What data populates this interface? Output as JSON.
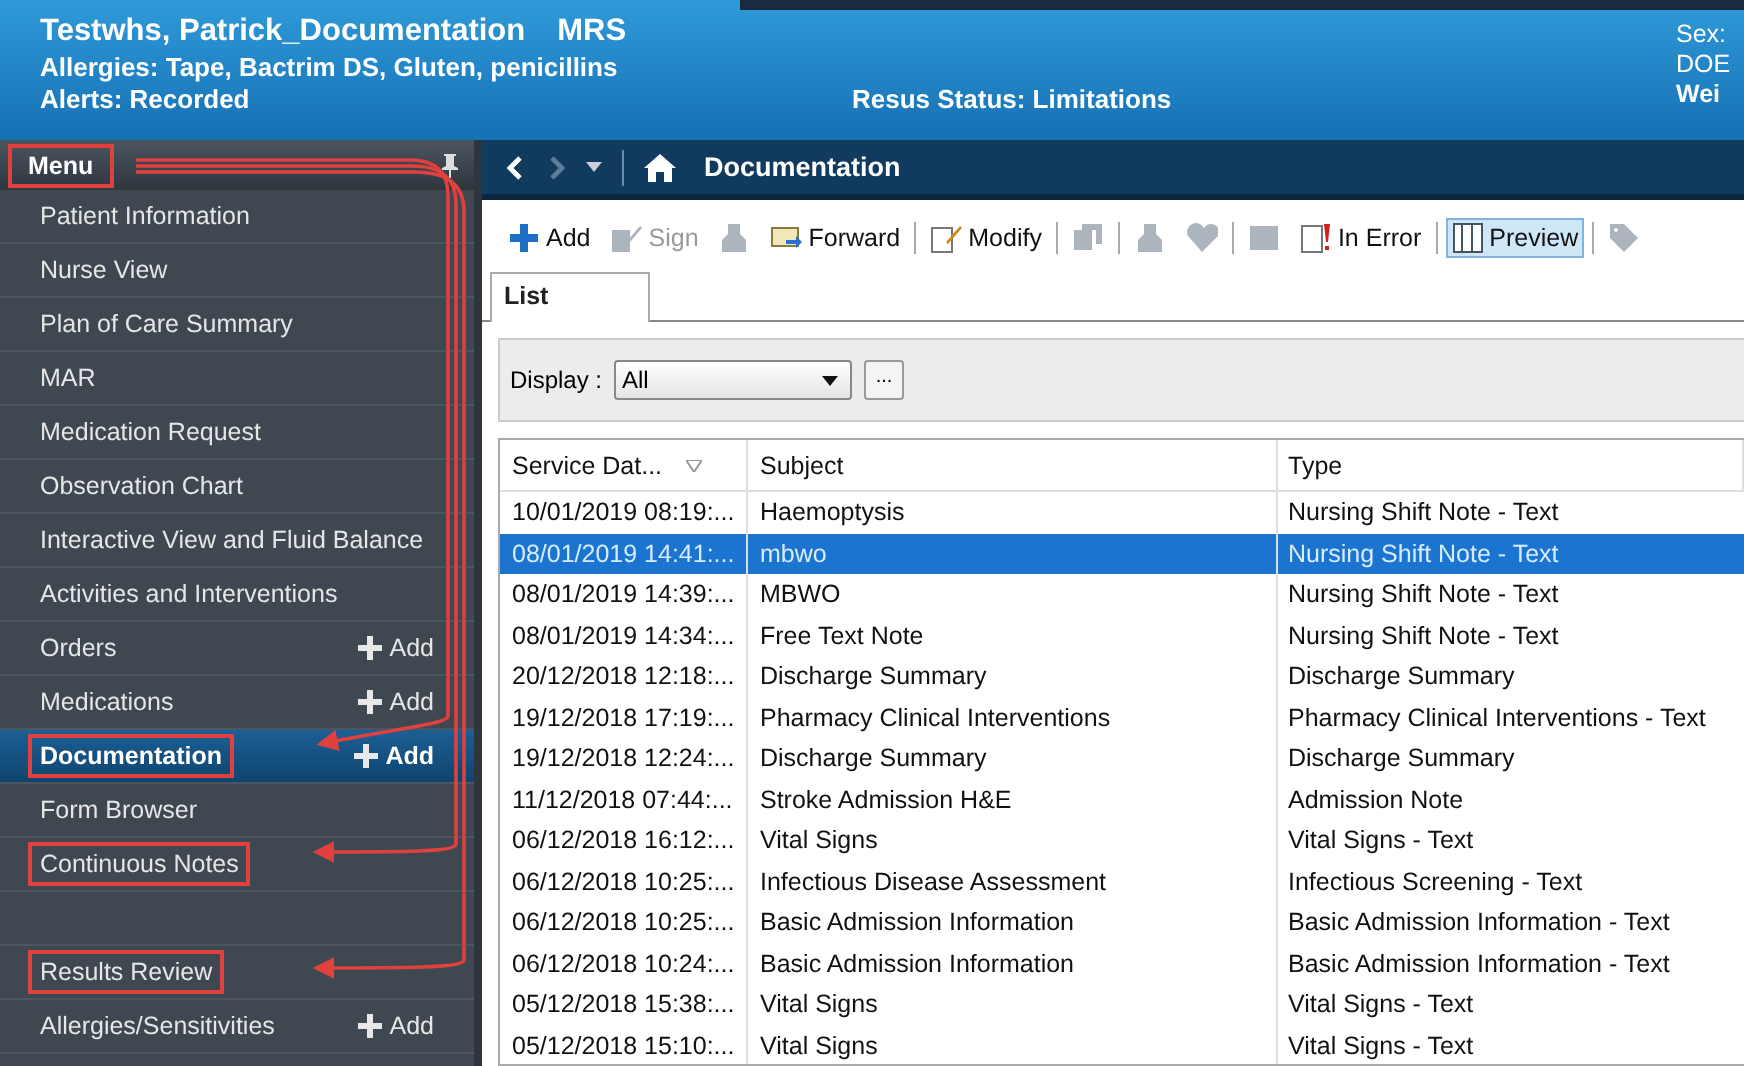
{
  "banner": {
    "patient": "Testwhs, Patrick_Documentation",
    "unit": "MRS",
    "allergies": "Allergies: Tape, Bactrim DS, Gluten, penicillins",
    "alerts": "Alerts: Recorded",
    "resus": "Resus Status: Limitations",
    "right_labels": [
      "Sex:",
      "DOE",
      "Wei"
    ]
  },
  "menu": {
    "title": "Menu",
    "highlighted": true,
    "items": [
      {
        "kind": "item",
        "label": "Patient Information",
        "selected": false,
        "highlighted": false
      },
      {
        "kind": "item",
        "label": "Nurse View",
        "selected": false,
        "highlighted": false
      },
      {
        "kind": "item",
        "label": "Plan of Care Summary",
        "selected": false,
        "highlighted": false
      },
      {
        "kind": "item",
        "label": "MAR",
        "selected": false,
        "highlighted": false
      },
      {
        "kind": "item",
        "label": "Medication Request",
        "selected": false,
        "highlighted": false
      },
      {
        "kind": "item",
        "label": "Observation Chart",
        "selected": false,
        "highlighted": false
      },
      {
        "kind": "item",
        "label": "Interactive View and Fluid Balance",
        "selected": false,
        "highlighted": false
      },
      {
        "kind": "item",
        "label": "Activities and Interventions",
        "selected": false,
        "highlighted": false
      },
      {
        "kind": "item",
        "label": "Orders",
        "add": "Add",
        "selected": false,
        "highlighted": false
      },
      {
        "kind": "item",
        "label": "Medications",
        "add": "Add",
        "selected": false,
        "highlighted": false
      },
      {
        "kind": "item",
        "label": "Documentation",
        "add": "Add",
        "selected": true,
        "highlighted": true
      },
      {
        "kind": "item",
        "label": "Form Browser",
        "selected": false,
        "highlighted": false
      },
      {
        "kind": "item",
        "label": "Continuous Notes",
        "selected": false,
        "highlighted": true
      },
      {
        "kind": "spacer"
      },
      {
        "kind": "item",
        "label": "Results Review",
        "selected": false,
        "highlighted": true
      },
      {
        "kind": "item",
        "label": "Allergies/Sensitivities",
        "add": "Add",
        "selected": false,
        "highlighted": false
      }
    ]
  },
  "navbar": {
    "title": "Documentation"
  },
  "toolbar": [
    {
      "kind": "button",
      "label": "Add",
      "disabled": false,
      "pressed": false
    },
    {
      "kind": "button",
      "label": "Sign",
      "disabled": true,
      "pressed": false
    },
    {
      "kind": "button",
      "disabled": true,
      "pressed": false
    },
    {
      "kind": "button",
      "label": "Forward",
      "disabled": false,
      "pressed": false
    },
    {
      "kind": "separator"
    },
    {
      "kind": "button",
      "label": "Modify",
      "disabled": false,
      "pressed": false
    },
    {
      "kind": "separator"
    },
    {
      "kind": "button",
      "disabled": true,
      "pressed": false
    },
    {
      "kind": "separator"
    },
    {
      "kind": "button",
      "disabled": true,
      "pressed": false
    },
    {
      "kind": "button",
      "disabled": true,
      "pressed": false
    },
    {
      "kind": "separator"
    },
    {
      "kind": "button",
      "disabled": true,
      "pressed": false
    },
    {
      "kind": "button",
      "label": "In Error",
      "disabled": false,
      "pressed": false
    },
    {
      "kind": "separator"
    },
    {
      "kind": "button",
      "label": "Preview",
      "disabled": false,
      "pressed": true
    },
    {
      "kind": "separator"
    },
    {
      "kind": "button",
      "disabled": true,
      "pressed": false
    }
  ],
  "tabs": [
    {
      "label": "List",
      "selected": true
    }
  ],
  "display": {
    "label": "Display :",
    "value": "All",
    "more": "..."
  },
  "table": {
    "columns": [
      "Service Dat...",
      "Subject",
      "Type"
    ],
    "rows": [
      {
        "date": "10/01/2019 08:19:...",
        "subject": "Haemoptysis",
        "type": "Nursing Shift Note - Text",
        "selected": false
      },
      {
        "date": "08/01/2019 14:41:...",
        "subject": "mbwo",
        "type": "Nursing Shift Note - Text",
        "selected": true
      },
      {
        "date": "08/01/2019 14:39:...",
        "subject": "MBWO",
        "type": "Nursing Shift Note - Text",
        "selected": false
      },
      {
        "date": "08/01/2019 14:34:...",
        "subject": "Free Text Note",
        "type": "Nursing Shift Note - Text",
        "selected": false
      },
      {
        "date": "20/12/2018 12:18:...",
        "subject": "Discharge Summary",
        "type": "Discharge Summary",
        "selected": false
      },
      {
        "date": "19/12/2018 17:19:...",
        "subject": "Pharmacy Clinical Interventions",
        "type": "Pharmacy Clinical Interventions - Text",
        "selected": false
      },
      {
        "date": "19/12/2018 12:24:...",
        "subject": "Discharge Summary",
        "type": "Discharge Summary",
        "selected": false
      },
      {
        "date": "11/12/2018 07:44:...",
        "subject": "Stroke Admission H&E",
        "type": "Admission Note",
        "selected": false
      },
      {
        "date": "06/12/2018 16:12:...",
        "subject": "Vital Signs",
        "type": "Vital Signs - Text",
        "selected": false
      },
      {
        "date": "06/12/2018 10:25:...",
        "subject": "Infectious Disease Assessment",
        "type": "Infectious Screening - Text",
        "selected": false
      },
      {
        "date": "06/12/2018 10:25:...",
        "subject": "Basic Admission Information",
        "type": "Basic Admission Information - Text",
        "selected": false
      },
      {
        "date": "06/12/2018 10:24:...",
        "subject": "Basic Admission Information",
        "type": "Basic Admission Information - Text",
        "selected": false
      },
      {
        "date": "05/12/2018 15:38:...",
        "subject": "Vital Signs",
        "type": "Vital Signs - Text",
        "selected": false
      },
      {
        "date": "05/12/2018 15:10:...",
        "subject": "Vital Signs",
        "type": "Vital Signs - Text",
        "selected": false
      }
    ]
  }
}
